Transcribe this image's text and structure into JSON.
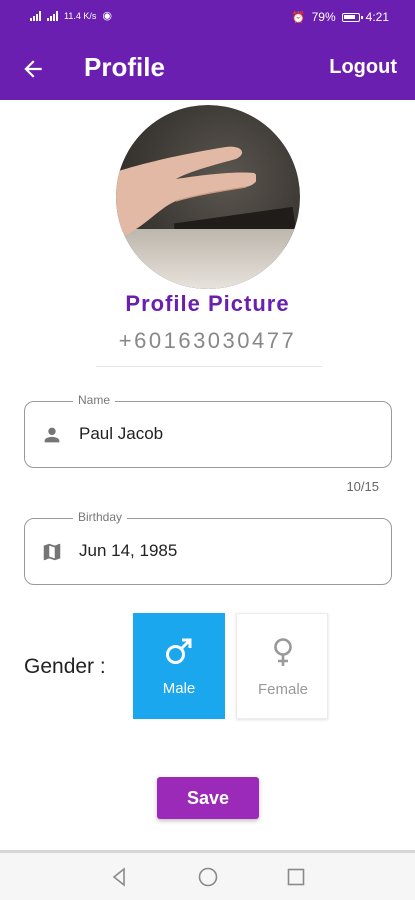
{
  "status_bar": {
    "left_text": "11.4 K/s",
    "battery_percent": "79%",
    "time": "4:21"
  },
  "app_bar": {
    "title": "Profile",
    "logout_label": "Logout"
  },
  "profile": {
    "picture_label": "Profile Picture",
    "phone": "+60163030477"
  },
  "name_field": {
    "label": "Name",
    "value": "Paul Jacob",
    "counter": "10/15"
  },
  "birthday_field": {
    "label": "Birthday",
    "value": "Jun 14, 1985"
  },
  "gender": {
    "label": "Gender :",
    "options": [
      {
        "label": "Male",
        "selected": true
      },
      {
        "label": "Female",
        "selected": false
      }
    ]
  },
  "save_label": "Save",
  "colors": {
    "primary": "#6a1fb0",
    "selected": "#1aa7ee",
    "save": "#9b2ab8"
  },
  "icons": {
    "back": "arrow-left-icon",
    "name": "person-icon",
    "birthday": "map-icon",
    "male": "male-symbol-icon",
    "female": "female-symbol-icon"
  }
}
